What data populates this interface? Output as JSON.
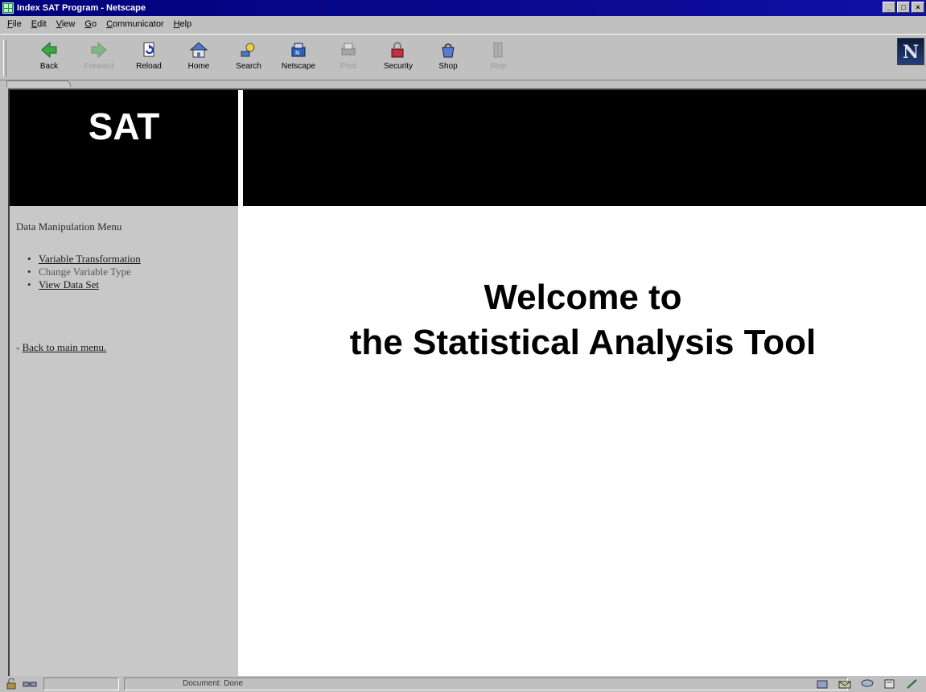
{
  "window": {
    "title": "Index SAT Program - Netscape",
    "controls": [
      "_",
      "□",
      "×"
    ]
  },
  "menubar": [
    "File",
    "Edit",
    "View",
    "Go",
    "Communicator",
    "Help"
  ],
  "toolbar": [
    {
      "label": "Back",
      "icon": "back-arrow-icon",
      "enabled": true
    },
    {
      "label": "Forward",
      "icon": "forward-arrow-icon",
      "enabled": false
    },
    {
      "label": "Reload",
      "icon": "reload-icon",
      "enabled": true
    },
    {
      "label": "Home",
      "icon": "home-icon",
      "enabled": true
    },
    {
      "label": "Search",
      "icon": "search-icon",
      "enabled": true
    },
    {
      "label": "Netscape",
      "icon": "netscape-icon",
      "enabled": true
    },
    {
      "label": "Print",
      "icon": "print-icon",
      "enabled": false
    },
    {
      "label": "Security",
      "icon": "security-icon",
      "enabled": true
    },
    {
      "label": "Shop",
      "icon": "shop-icon",
      "enabled": true
    },
    {
      "label": "Stop",
      "icon": "stop-icon",
      "enabled": false
    }
  ],
  "logo_letter": "N",
  "header": {
    "logo_text": "SAT"
  },
  "menu": {
    "heading": "Data Manipulation Menu",
    "items": [
      {
        "label": "Variable Transformation",
        "link": true
      },
      {
        "label": "Change Variable Type",
        "link": false
      },
      {
        "label": "View Data Set",
        "link": true
      }
    ],
    "back_prefix": "- ",
    "back_link": "Back to main menu."
  },
  "main": {
    "welcome_line1": "Welcome to",
    "welcome_line2": "the Statistical Analysis Tool"
  },
  "status": {
    "text": "Document: Done"
  },
  "colors": {
    "titlebar": "#00007b",
    "chrome": "#c0c0c0",
    "frame_black": "#000000",
    "menu_bg": "#c8c8c8"
  }
}
